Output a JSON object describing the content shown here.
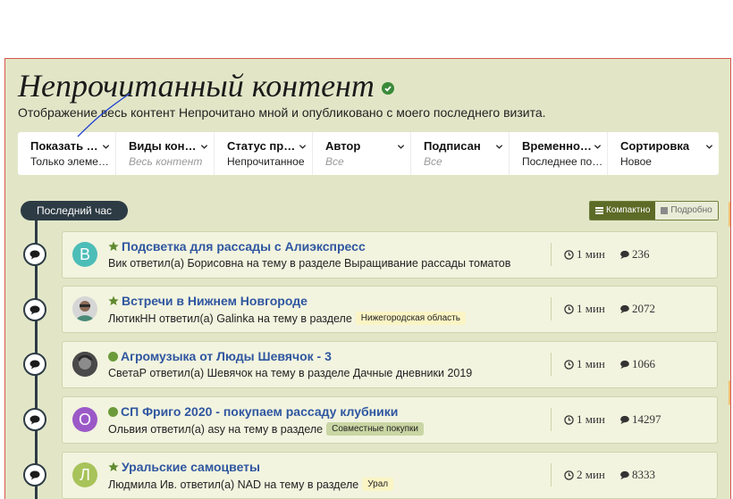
{
  "page": {
    "title": "Непрочитанный контент",
    "subtitle": "Отображение весь контент Непрочитано мной и опубликовано с моего последнего визита."
  },
  "filters": [
    {
      "label": "Показать материалы",
      "value": "Только элементы",
      "placeholder": false
    },
    {
      "label": "Виды контента",
      "value": "Весь контент",
      "placeholder": true
    },
    {
      "label": "Статус прочтения",
      "value": "Непрочитанное",
      "placeholder": false
    },
    {
      "label": "Автор",
      "value": "Все",
      "placeholder": true
    },
    {
      "label": "Подписан",
      "value": "Все",
      "placeholder": true
    },
    {
      "label": "Временной период",
      "value": "Последнее посещение",
      "placeholder": false
    },
    {
      "label": "Сортировка",
      "value": "Новое",
      "placeholder": false
    }
  ],
  "time_group": "Последний час",
  "view_toggle": {
    "compact": "Компактно",
    "detailed": "Подробно",
    "active": "compact"
  },
  "topics": [
    {
      "avatar_letter": "В",
      "avatar_color": "#4dbdb8",
      "icon": "star-icon",
      "title": "Подсветка для рассады с Алиэкспресс",
      "summary": "Вик ответил(а) Борисовна на тему в разделе Выращивание рассады томатов",
      "tag": "",
      "tag_bg": "",
      "time": "1 мин",
      "replies": "236"
    },
    {
      "avatar_letter": "",
      "avatar_color": "#c9c9c9",
      "icon": "star-icon",
      "title": "Встречи в Нижнем Новгороде",
      "summary": "ЛютикНН ответил(а) Galinka на тему в разделе",
      "tag": "Нижегородская область",
      "tag_bg": "#fbf4c4",
      "time": "1 мин",
      "replies": "2072"
    },
    {
      "avatar_letter": "",
      "avatar_color": "#5a5a5a",
      "icon": "dot-icon",
      "title": "Агромузыка от Люды Шевячок - 3",
      "summary": "СветаР ответил(а) Шевячок на тему в разделе Дачные дневники 2019",
      "tag": "",
      "tag_bg": "",
      "time": "1 мин",
      "replies": "1066"
    },
    {
      "avatar_letter": "О",
      "avatar_color": "#9b59c7",
      "icon": "dot-icon",
      "title": "СП Фриго 2020 - покупаем рассаду клубники",
      "summary": "Ольвия ответил(а) asy на тему в разделе",
      "tag": "Совместные покупки",
      "tag_bg": "#c9d6a4",
      "time": "1 мин",
      "replies": "14297"
    },
    {
      "avatar_letter": "Л",
      "avatar_color": "#a8c35a",
      "icon": "star-icon",
      "title": "Уральские самоцветы",
      "summary": "Людмила Ив. ответил(а) NAD на тему в разделе",
      "tag": "Урал",
      "tag_bg": "#fbf4c4",
      "time": "2 мин",
      "replies": "8333"
    }
  ]
}
